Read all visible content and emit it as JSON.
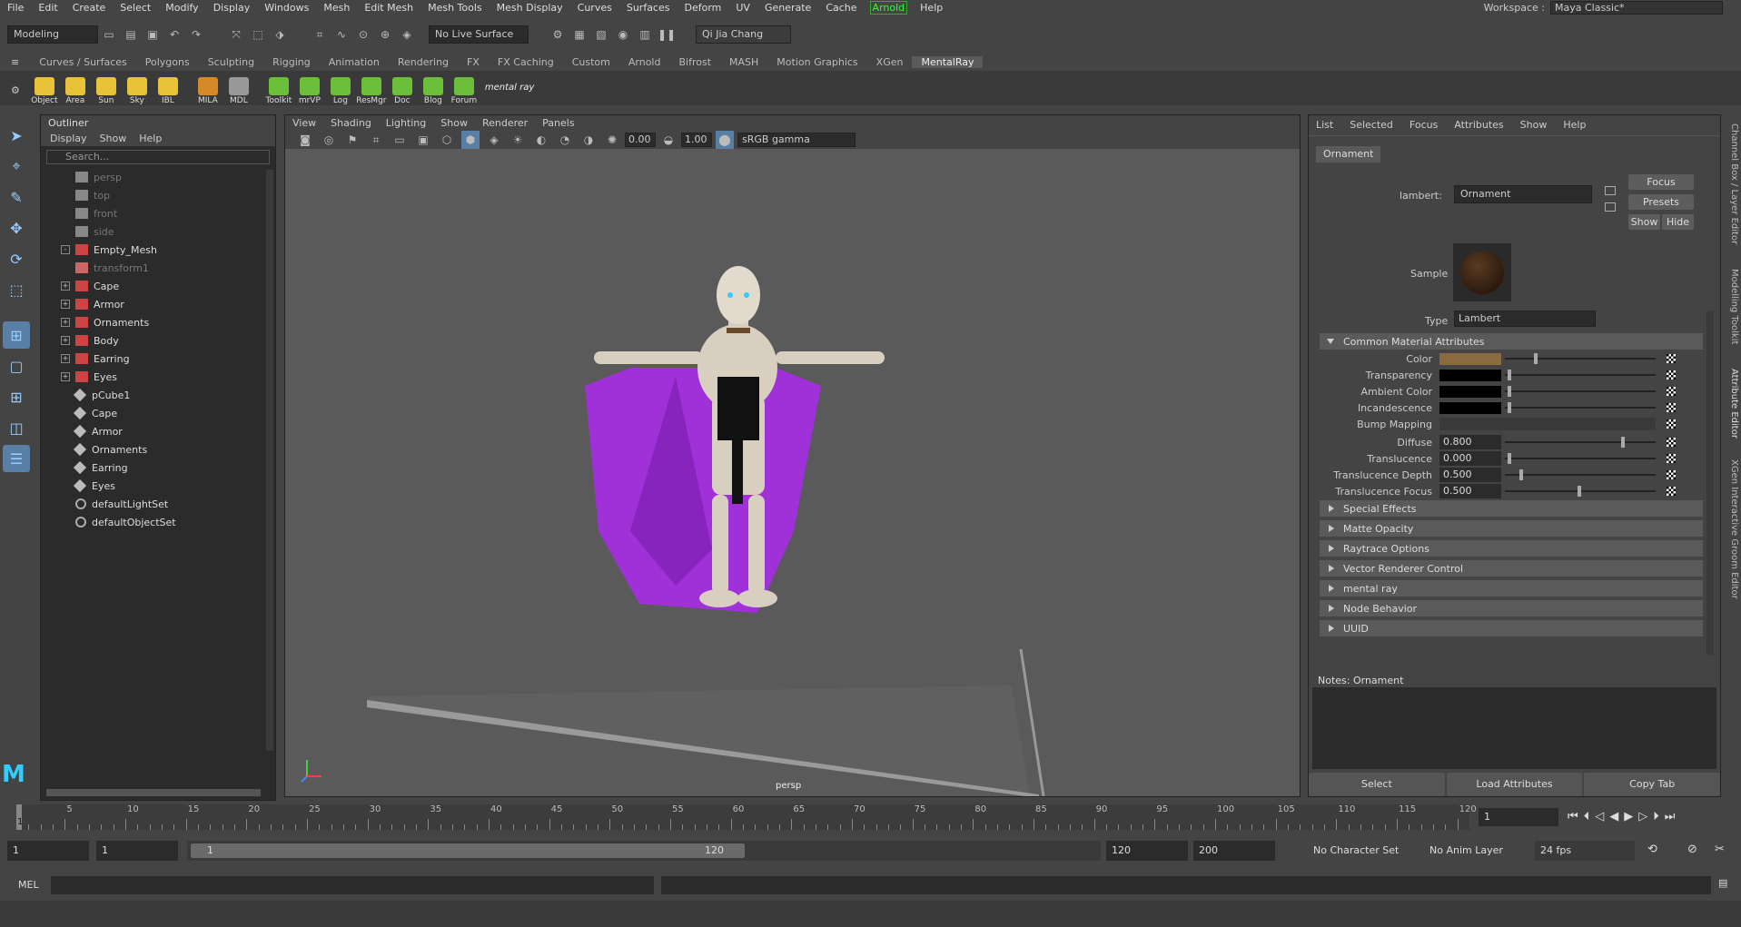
{
  "menubar": {
    "items": [
      "File",
      "Edit",
      "Create",
      "Select",
      "Modify",
      "Display",
      "Windows",
      "Mesh",
      "Edit Mesh",
      "Mesh Tools",
      "Mesh Display",
      "Curves",
      "Surfaces",
      "Deform",
      "UV",
      "Generate",
      "Cache",
      "Arnold",
      "Help"
    ],
    "workspace_label": "Workspace :",
    "workspace_value": "Maya Classic*"
  },
  "statusline": {
    "mode": "Modeling",
    "live_surface": "No Live Surface",
    "user": "Qi Jia Chang"
  },
  "shelf": {
    "tabs": [
      "Curves / Surfaces",
      "Polygons",
      "Sculpting",
      "Rigging",
      "Animation",
      "Rendering",
      "FX",
      "FX Caching",
      "Custom",
      "Arnold",
      "Bifrost",
      "MASH",
      "Motion Graphics",
      "XGen",
      "MentalRay"
    ],
    "active_tab": "MentalRay",
    "buttons": [
      "Object",
      "Area",
      "Sun",
      "Sky",
      "IBL",
      "MILA",
      "MDL",
      "Toolkit",
      "mrVP",
      "Log",
      "ResMgr",
      "Doc",
      "Blog",
      "Forum"
    ],
    "logo": "mental ray"
  },
  "outliner": {
    "title": "Outliner",
    "menu": [
      "Display",
      "Show",
      "Help"
    ],
    "search_placeholder": "Search...",
    "rows": [
      {
        "label": "persp",
        "dim": true,
        "indent": 1,
        "type": "camera"
      },
      {
        "label": "top",
        "dim": true,
        "indent": 1,
        "type": "camera"
      },
      {
        "label": "front",
        "dim": true,
        "indent": 1,
        "type": "camera"
      },
      {
        "label": "side",
        "dim": true,
        "indent": 1,
        "type": "camera"
      },
      {
        "label": "Empty_Mesh",
        "dim": false,
        "indent": 0,
        "type": "group",
        "expander": "-"
      },
      {
        "label": "transform1",
        "dim": true,
        "indent": 1,
        "type": "mesh"
      },
      {
        "label": "Cape",
        "dim": false,
        "indent": 1,
        "type": "group",
        "expander": "+"
      },
      {
        "label": "Armor",
        "dim": false,
        "indent": 1,
        "type": "group",
        "expander": "+"
      },
      {
        "label": "Ornaments",
        "dim": false,
        "indent": 1,
        "type": "group",
        "expander": "+"
      },
      {
        "label": "Body",
        "dim": false,
        "indent": 1,
        "type": "group",
        "expander": "+"
      },
      {
        "label": "Earring",
        "dim": false,
        "indent": 1,
        "type": "group",
        "expander": "+"
      },
      {
        "label": "Eyes",
        "dim": false,
        "indent": 1,
        "type": "group",
        "expander": "+"
      },
      {
        "label": "pCube1",
        "dim": false,
        "indent": 1,
        "type": "shape"
      },
      {
        "label": "Cape",
        "dim": false,
        "indent": 1,
        "type": "shape"
      },
      {
        "label": "Armor",
        "dim": false,
        "indent": 1,
        "type": "shape"
      },
      {
        "label": "Ornaments",
        "dim": false,
        "indent": 1,
        "type": "shape"
      },
      {
        "label": "Earring",
        "dim": false,
        "indent": 1,
        "type": "shape"
      },
      {
        "label": "Eyes",
        "dim": false,
        "indent": 1,
        "type": "shape"
      },
      {
        "label": "defaultLightSet",
        "dim": false,
        "indent": 1,
        "type": "set"
      },
      {
        "label": "defaultObjectSet",
        "dim": false,
        "indent": 1,
        "type": "set"
      }
    ]
  },
  "viewport": {
    "menu": [
      "View",
      "Shading",
      "Lighting",
      "Show",
      "Renderer",
      "Panels"
    ],
    "exposure": "0.00",
    "gamma": "1.00",
    "color_space": "sRGB gamma",
    "camera_label": "persp"
  },
  "attribute_editor": {
    "menu": [
      "List",
      "Selected",
      "Focus",
      "Attributes",
      "Show",
      "Help"
    ],
    "tab": "Ornament",
    "node_type_label": "lambert:",
    "node_name": "Ornament",
    "buttons": {
      "focus": "Focus",
      "presets": "Presets",
      "show": "Show",
      "hide": "Hide"
    },
    "sample_label": "Sample",
    "type_label": "Type",
    "type_value": "Lambert",
    "common_section": "Common Material Attributes",
    "attrs": [
      {
        "label": "Color",
        "kind": "color",
        "color": "#8a6a3f",
        "slider": 0.2
      },
      {
        "label": "Transparency",
        "kind": "color",
        "color": "#000000",
        "slider": 0.02
      },
      {
        "label": "Ambient Color",
        "kind": "color",
        "color": "#000000",
        "slider": 0.02
      },
      {
        "label": "Incandescence",
        "kind": "color",
        "color": "#000000",
        "slider": 0.02
      },
      {
        "label": "Bump Mapping",
        "kind": "bump"
      },
      {
        "label": "Diffuse",
        "kind": "num",
        "value": "0.800",
        "slider": 0.8
      },
      {
        "label": "Translucence",
        "kind": "num",
        "value": "0.000",
        "slider": 0.02
      },
      {
        "label": "Translucence Depth",
        "kind": "num",
        "value": "0.500",
        "slider": 0.1
      },
      {
        "label": "Translucence Focus",
        "kind": "num",
        "value": "0.500",
        "slider": 0.5
      }
    ],
    "sections": [
      "Special Effects",
      "Matte Opacity",
      "Raytrace Options",
      "Vector Renderer Control",
      "mental ray",
      "Node Behavior",
      "UUID"
    ],
    "notes_label": "Notes:  Ornament",
    "bottom_buttons": [
      "Select",
      "Load Attributes",
      "Copy Tab"
    ]
  },
  "side_tabs": [
    "Channel Box / Layer Editor",
    "Modelling Toolkit",
    "Attribute Editor",
    "XGen Interactive Groom Editor"
  ],
  "timeline": {
    "ticks": [
      "5",
      "10",
      "15",
      "20",
      "25",
      "30",
      "35",
      "40",
      "45",
      "50",
      "55",
      "60",
      "65",
      "70",
      "75",
      "80",
      "85",
      "90",
      "95",
      "100",
      "105",
      "110",
      "115",
      "120"
    ],
    "current_frame_marker": "1",
    "current_frame": "1"
  },
  "range": {
    "start": "1",
    "playback_start": "1",
    "range_start": "1",
    "range_end": "120",
    "playback_end": "120",
    "end": "200",
    "character_set": "No Character Set",
    "anim_layer": "No Anim Layer",
    "fps": "24 fps"
  },
  "cmdline": {
    "label": "MEL"
  }
}
